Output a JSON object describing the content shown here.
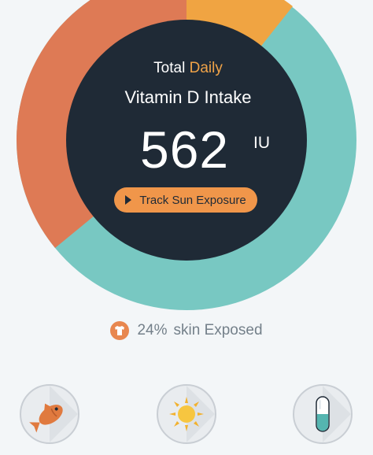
{
  "header": {
    "title_prefix": "Total",
    "title_accent": "Daily",
    "subtitle": "Vitamin D Intake"
  },
  "intake": {
    "value": "562",
    "unit": "IU"
  },
  "track_button": {
    "label": "Track Sun Exposure"
  },
  "skin": {
    "percent": "24%",
    "label": "skin Exposed"
  },
  "colors": {
    "teal": "#78c8c2",
    "orange": "#de7a55",
    "amber": "#f0a442",
    "center": "#1f2a36",
    "accent_text": "#f0a348"
  },
  "sources": [
    {
      "name": "fish",
      "icon": "fish-icon"
    },
    {
      "name": "sun",
      "icon": "sun-icon"
    },
    {
      "name": "supplement",
      "icon": "pill-icon"
    }
  ]
}
